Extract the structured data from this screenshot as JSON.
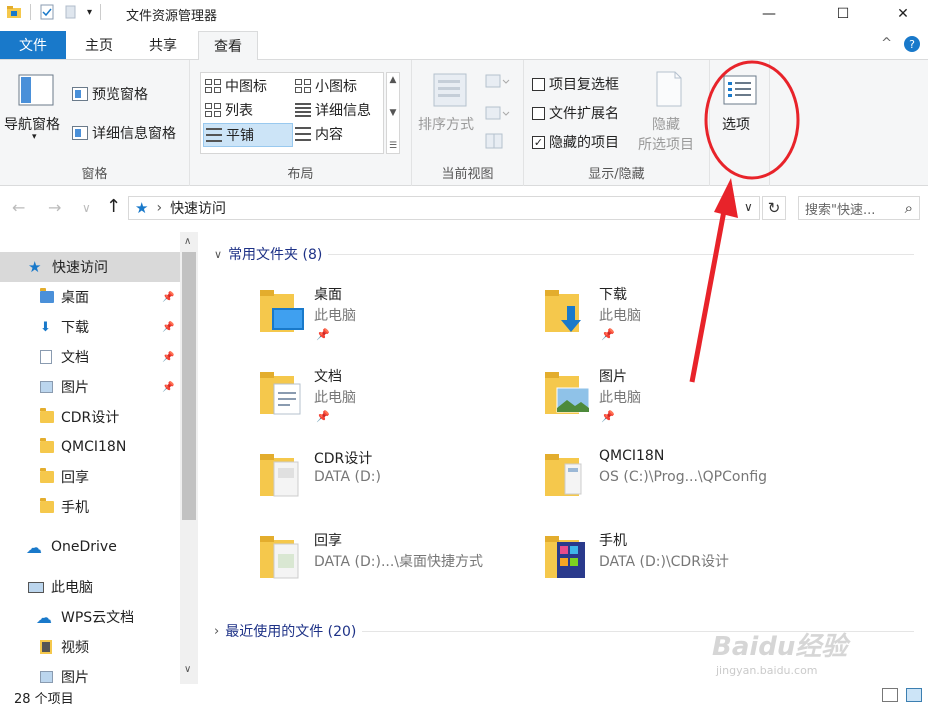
{
  "window": {
    "title": "文件资源管理器",
    "min": "—",
    "max": "☐",
    "close": "✕"
  },
  "tabs": {
    "file": "文件",
    "home": "主页",
    "share": "共享",
    "view": "查看",
    "collapse": "^",
    "help": "?"
  },
  "ribbon": {
    "panes": {
      "label": "窗格",
      "nav_pane": "导航窗格",
      "preview_pane": "预览窗格",
      "details_pane": "详细信息窗格"
    },
    "layout": {
      "label": "布局",
      "medium_icons": "中图标",
      "small_icons": "小图标",
      "list": "列表",
      "details": "详细信息",
      "tiles": "平铺",
      "content": "内容"
    },
    "current_view": {
      "label": "当前视图",
      "sort_by": "排序方式"
    },
    "show_hide": {
      "label": "显示/隐藏",
      "item_checkboxes": "项目复选框",
      "file_extensions": "文件扩展名",
      "hidden_items": "隐藏的项目",
      "hide_selected_line1": "隐藏",
      "hide_selected_line2": "所选项目",
      "checked_mark": "✓"
    },
    "options": {
      "label": "选项"
    }
  },
  "address": {
    "back": "←",
    "forward": "→",
    "recent": "∨",
    "up": "↑",
    "star": "★",
    "chev": "›",
    "location": "快速访问",
    "dropdown": "∨",
    "refresh": "↻",
    "search_placeholder": "搜索\"快速...",
    "search_icon": "⌕"
  },
  "nav": {
    "items": [
      {
        "label": "快速访问"
      },
      {
        "label": "桌面"
      },
      {
        "label": "下载"
      },
      {
        "label": "文档"
      },
      {
        "label": "图片"
      },
      {
        "label": "CDR设计"
      },
      {
        "label": "QMCI18N"
      },
      {
        "label": "回享"
      },
      {
        "label": "手机"
      },
      {
        "label": "OneDrive"
      },
      {
        "label": "此电脑"
      },
      {
        "label": "WPS云文档"
      },
      {
        "label": "视频"
      },
      {
        "label": "图片"
      }
    ],
    "pin": "📌",
    "scroll_up": "∧",
    "scroll_down": "∨"
  },
  "content": {
    "frequent_header": "常用文件夹 (8)",
    "recent_header": "最近使用的文件 (20)",
    "expanded_chev": "∨",
    "collapsed_chev": "›",
    "folders": [
      {
        "name": "桌面",
        "sub": "此电脑",
        "pinned": true
      },
      {
        "name": "下载",
        "sub": "此电脑",
        "pinned": true
      },
      {
        "name": "文档",
        "sub": "此电脑",
        "pinned": true
      },
      {
        "name": "图片",
        "sub": "此电脑",
        "pinned": true
      },
      {
        "name": "CDR设计",
        "sub": "DATA (D:)",
        "pinned": false
      },
      {
        "name": "QMCI18N",
        "sub": "OS (C:)\\Prog...\\QPConfig",
        "pinned": false
      },
      {
        "name": "回享",
        "sub": "DATA (D:)...\\桌面快捷方式",
        "pinned": false
      },
      {
        "name": "手机",
        "sub": "DATA (D:)\\CDR设计",
        "pinned": false
      }
    ],
    "pin": "📌"
  },
  "status": {
    "count": "28 个项目"
  },
  "watermark": {
    "main": "Baidu经验",
    "sub": "jingyan.baidu.com"
  },
  "colors": {
    "accent": "#1979ca",
    "annotation": "#e8232a",
    "folder": "#f5c84c"
  }
}
